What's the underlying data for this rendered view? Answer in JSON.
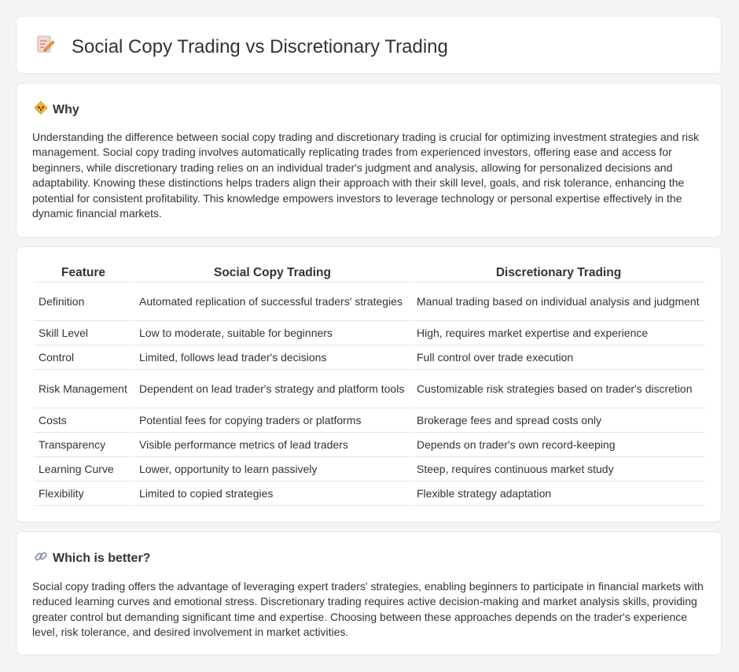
{
  "header": {
    "title": "Social Copy Trading vs Discretionary Trading",
    "icon": "document-pencil-icon"
  },
  "why": {
    "title": "Why",
    "icon": "lightbulb-icon",
    "text": "Understanding the difference between social copy trading and discretionary trading is crucial for optimizing investment strategies and risk management. Social copy trading involves automatically replicating trades from experienced investors, offering ease and access for beginners, while discretionary trading relies on an individual trader's judgment and analysis, allowing for personalized decisions and adaptability. Knowing these distinctions helps traders align their approach with their skill level, goals, and risk tolerance, enhancing the potential for consistent profitability. This knowledge empowers investors to leverage technology or personal expertise effectively in the dynamic financial markets."
  },
  "table": {
    "headers": [
      "Feature",
      "Social Copy Trading",
      "Discretionary Trading"
    ],
    "rows": [
      [
        "Definition",
        "Automated replication of successful traders' strategies",
        "Manual trading based on individual analysis and judgment"
      ],
      [
        "Skill Level",
        "Low to moderate, suitable for beginners",
        "High, requires market expertise and experience"
      ],
      [
        "Control",
        "Limited, follows lead trader's decisions",
        "Full control over trade execution"
      ],
      [
        "Risk Management",
        "Dependent on lead trader's strategy and platform tools",
        "Customizable risk strategies based on trader's discretion"
      ],
      [
        "Costs",
        "Potential fees for copying traders or platforms",
        "Brokerage fees and spread costs only"
      ],
      [
        "Transparency",
        "Visible performance metrics of lead traders",
        "Depends on trader's own record-keeping"
      ],
      [
        "Learning Curve",
        "Lower, opportunity to learn passively",
        "Steep, requires continuous market study"
      ],
      [
        "Flexibility",
        "Limited to copied strategies",
        "Flexible strategy adaptation"
      ]
    ]
  },
  "better": {
    "title": "Which is better?",
    "icon": "link-icon",
    "text": "Social copy trading offers the advantage of leveraging expert traders' strategies, enabling beginners to participate in financial markets with reduced learning curves and emotional stress. Discretionary trading requires active decision-making and market analysis skills, providing greater control but demanding significant time and expertise. Choosing between these approaches depends on the trader's experience level, risk tolerance, and desired involvement in market activities."
  }
}
